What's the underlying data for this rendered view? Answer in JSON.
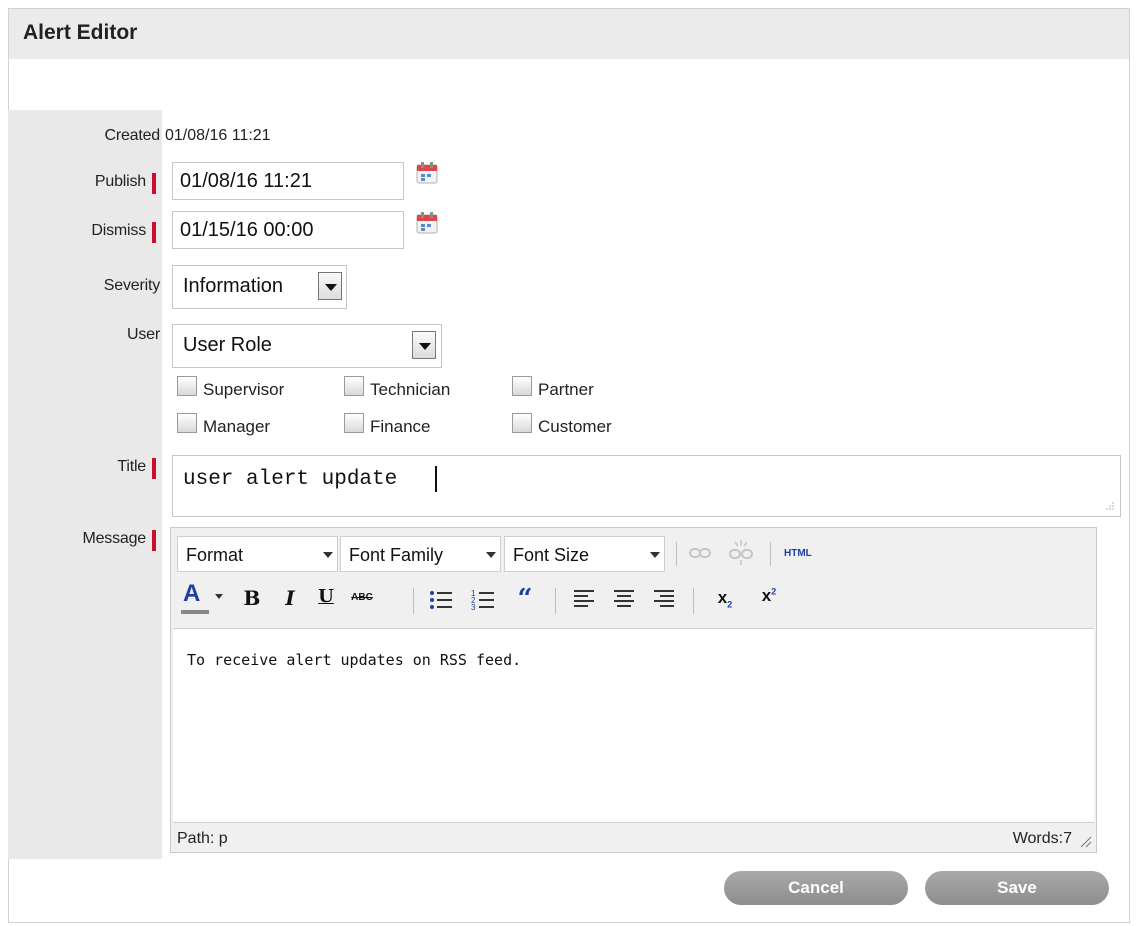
{
  "panel": {
    "title": "Alert Editor"
  },
  "form": {
    "created": {
      "label": "Created",
      "value": "01/08/16 11:21"
    },
    "publish": {
      "label": "Publish",
      "value": "01/08/16 11:21"
    },
    "dismiss": {
      "label": "Dismiss",
      "value": "01/15/16 00:00"
    },
    "severity": {
      "label": "Severity",
      "value": "Information"
    },
    "user": {
      "label": "User",
      "value": "User Role",
      "roles": [
        "Supervisor",
        "Technician",
        "Partner",
        "Manager",
        "Finance",
        "Customer"
      ]
    },
    "title": {
      "label": "Title",
      "value": "user alert update"
    },
    "message": {
      "label": "Message"
    }
  },
  "editor": {
    "dropdowns": [
      "Format",
      "Font Family",
      "Font Size"
    ],
    "html_label": "HTML",
    "content": "To receive alert updates on RSS feed.",
    "path": "Path: p",
    "words": "Words:7"
  },
  "actions": {
    "cancel": "Cancel",
    "save": "Save"
  },
  "colors": {
    "required_marker": "#c8102e",
    "header_bg": "#ebebeb",
    "label_bg": "#e9e9e9",
    "button_bg": "#999999"
  }
}
